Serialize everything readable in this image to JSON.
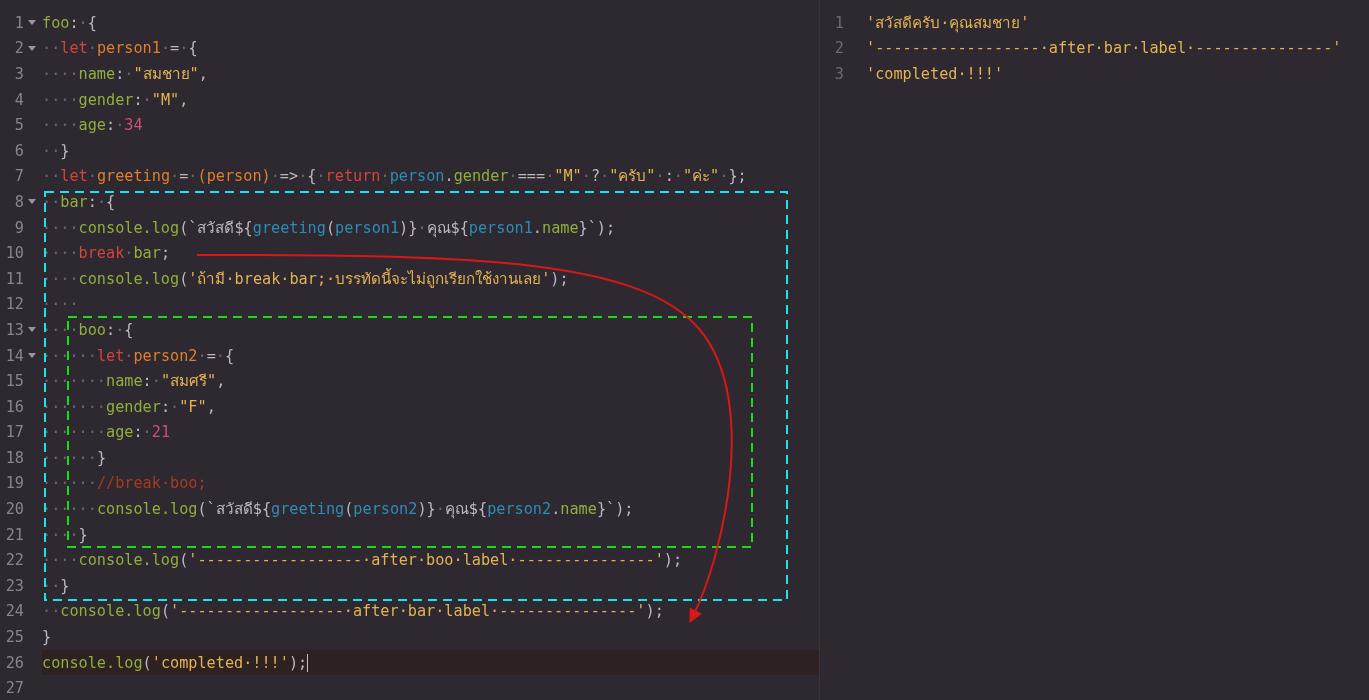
{
  "editor": {
    "lines": [
      {
        "number": "1",
        "fold": true,
        "selected": false,
        "tokens": [
          {
            "kind": "prop",
            "text": "foo"
          },
          {
            "kind": "plain",
            "text": ":"
          },
          {
            "kind": "space",
            "text": "·"
          },
          {
            "kind": "plain",
            "text": "{"
          }
        ]
      },
      {
        "number": "2",
        "fold": true,
        "selected": false,
        "tokens": [
          {
            "kind": "space",
            "text": "··"
          },
          {
            "kind": "keyword",
            "text": "let"
          },
          {
            "kind": "space",
            "text": "·"
          },
          {
            "kind": "var",
            "text": "person1"
          },
          {
            "kind": "space",
            "text": "·"
          },
          {
            "kind": "plain",
            "text": "="
          },
          {
            "kind": "space",
            "text": "·"
          },
          {
            "kind": "plain",
            "text": "{"
          }
        ]
      },
      {
        "number": "3",
        "fold": false,
        "selected": false,
        "tokens": [
          {
            "kind": "space",
            "text": "····"
          },
          {
            "kind": "prop",
            "text": "name"
          },
          {
            "kind": "plain",
            "text": ":"
          },
          {
            "kind": "space",
            "text": "·"
          },
          {
            "kind": "string",
            "text": "\"สมชาย\""
          },
          {
            "kind": "plain",
            "text": ","
          }
        ]
      },
      {
        "number": "4",
        "fold": false,
        "selected": false,
        "tokens": [
          {
            "kind": "space",
            "text": "····"
          },
          {
            "kind": "prop",
            "text": "gender"
          },
          {
            "kind": "plain",
            "text": ":"
          },
          {
            "kind": "space",
            "text": "·"
          },
          {
            "kind": "string",
            "text": "\"M\""
          },
          {
            "kind": "plain",
            "text": ","
          }
        ]
      },
      {
        "number": "5",
        "fold": false,
        "selected": false,
        "tokens": [
          {
            "kind": "space",
            "text": "····"
          },
          {
            "kind": "prop",
            "text": "age"
          },
          {
            "kind": "plain",
            "text": ":"
          },
          {
            "kind": "space",
            "text": "·"
          },
          {
            "kind": "number",
            "text": "34"
          }
        ]
      },
      {
        "number": "6",
        "fold": false,
        "selected": false,
        "tokens": [
          {
            "kind": "space",
            "text": "··"
          },
          {
            "kind": "plain",
            "text": "}"
          }
        ]
      },
      {
        "number": "7",
        "fold": false,
        "selected": false,
        "tokens": [
          {
            "kind": "space",
            "text": "··"
          },
          {
            "kind": "keyword",
            "text": "let"
          },
          {
            "kind": "space",
            "text": "·"
          },
          {
            "kind": "var",
            "text": "greeting"
          },
          {
            "kind": "space",
            "text": "·"
          },
          {
            "kind": "plain",
            "text": "="
          },
          {
            "kind": "space",
            "text": "·"
          },
          {
            "kind": "var",
            "text": "(person)"
          },
          {
            "kind": "space",
            "text": "·"
          },
          {
            "kind": "plain",
            "text": "=>"
          },
          {
            "kind": "space",
            "text": "·"
          },
          {
            "kind": "plain",
            "text": "{"
          },
          {
            "kind": "space",
            "text": "·"
          },
          {
            "kind": "keyword",
            "text": "return"
          },
          {
            "kind": "space",
            "text": "·"
          },
          {
            "kind": "ref",
            "text": "person"
          },
          {
            "kind": "plain",
            "text": "."
          },
          {
            "kind": "prop",
            "text": "gender"
          },
          {
            "kind": "space",
            "text": "·"
          },
          {
            "kind": "plain",
            "text": "==="
          },
          {
            "kind": "space",
            "text": "·"
          },
          {
            "kind": "string",
            "text": "\"M\""
          },
          {
            "kind": "space",
            "text": "·"
          },
          {
            "kind": "plain",
            "text": "?"
          },
          {
            "kind": "space",
            "text": "·"
          },
          {
            "kind": "string",
            "text": "\"ครับ\""
          },
          {
            "kind": "space",
            "text": "·"
          },
          {
            "kind": "plain",
            "text": ":"
          },
          {
            "kind": "space",
            "text": "·"
          },
          {
            "kind": "string",
            "text": "\"ค่ะ\""
          },
          {
            "kind": "space",
            "text": "·"
          },
          {
            "kind": "plain",
            "text": "};"
          }
        ]
      },
      {
        "number": "8",
        "fold": true,
        "selected": false,
        "tokens": [
          {
            "kind": "space",
            "text": "··"
          },
          {
            "kind": "prop",
            "text": "bar"
          },
          {
            "kind": "plain",
            "text": ":"
          },
          {
            "kind": "space",
            "text": "·"
          },
          {
            "kind": "plain",
            "text": "{"
          }
        ]
      },
      {
        "number": "9",
        "fold": false,
        "selected": false,
        "tokens": [
          {
            "kind": "space",
            "text": "····"
          },
          {
            "kind": "prop",
            "text": "console.log"
          },
          {
            "kind": "plain",
            "text": "(`สวัสดี${"
          },
          {
            "kind": "ref",
            "text": "greeting"
          },
          {
            "kind": "plain",
            "text": "("
          },
          {
            "kind": "ref",
            "text": "person1"
          },
          {
            "kind": "plain",
            "text": ")}"
          },
          {
            "kind": "space",
            "text": "·"
          },
          {
            "kind": "plain",
            "text": "คุณ${"
          },
          {
            "kind": "ref",
            "text": "person1"
          },
          {
            "kind": "plain",
            "text": "."
          },
          {
            "kind": "prop",
            "text": "name"
          },
          {
            "kind": "plain",
            "text": "}`);"
          }
        ]
      },
      {
        "number": "10",
        "fold": false,
        "selected": false,
        "tokens": [
          {
            "kind": "space",
            "text": "····"
          },
          {
            "kind": "keyword",
            "text": "break"
          },
          {
            "kind": "space",
            "text": "·"
          },
          {
            "kind": "prop",
            "text": "bar"
          },
          {
            "kind": "plain",
            "text": ";"
          }
        ]
      },
      {
        "number": "11",
        "fold": false,
        "selected": false,
        "tokens": [
          {
            "kind": "space",
            "text": "····"
          },
          {
            "kind": "prop",
            "text": "console.log"
          },
          {
            "kind": "plain",
            "text": "("
          },
          {
            "kind": "string",
            "text": "'ถ้ามี·break·bar;·บรรทัดนี้จะไม่ถูกเรียกใช้งานเลย'"
          },
          {
            "kind": "plain",
            "text": ");"
          }
        ]
      },
      {
        "number": "12",
        "fold": false,
        "selected": false,
        "tokens": [
          {
            "kind": "space",
            "text": "····"
          }
        ]
      },
      {
        "number": "13",
        "fold": true,
        "selected": false,
        "tokens": [
          {
            "kind": "space",
            "text": "····"
          },
          {
            "kind": "prop",
            "text": "boo"
          },
          {
            "kind": "plain",
            "text": ":"
          },
          {
            "kind": "space",
            "text": "·"
          },
          {
            "kind": "plain",
            "text": "{"
          }
        ]
      },
      {
        "number": "14",
        "fold": true,
        "selected": false,
        "tokens": [
          {
            "kind": "space",
            "text": "······"
          },
          {
            "kind": "keyword",
            "text": "let"
          },
          {
            "kind": "space",
            "text": "·"
          },
          {
            "kind": "var",
            "text": "person2"
          },
          {
            "kind": "space",
            "text": "·"
          },
          {
            "kind": "plain",
            "text": "="
          },
          {
            "kind": "space",
            "text": "·"
          },
          {
            "kind": "plain",
            "text": "{"
          }
        ]
      },
      {
        "number": "15",
        "fold": false,
        "selected": false,
        "tokens": [
          {
            "kind": "space",
            "text": "·······"
          },
          {
            "kind": "prop",
            "text": "name"
          },
          {
            "kind": "plain",
            "text": ":"
          },
          {
            "kind": "space",
            "text": "·"
          },
          {
            "kind": "string",
            "text": "\"สมศรี\""
          },
          {
            "kind": "plain",
            "text": ","
          }
        ]
      },
      {
        "number": "16",
        "fold": false,
        "selected": false,
        "tokens": [
          {
            "kind": "space",
            "text": "·······"
          },
          {
            "kind": "prop",
            "text": "gender"
          },
          {
            "kind": "plain",
            "text": ":"
          },
          {
            "kind": "space",
            "text": "·"
          },
          {
            "kind": "string",
            "text": "\"F\""
          },
          {
            "kind": "plain",
            "text": ","
          }
        ]
      },
      {
        "number": "17",
        "fold": false,
        "selected": false,
        "tokens": [
          {
            "kind": "space",
            "text": "·······"
          },
          {
            "kind": "prop",
            "text": "age"
          },
          {
            "kind": "plain",
            "text": ":"
          },
          {
            "kind": "space",
            "text": "·"
          },
          {
            "kind": "number",
            "text": "21"
          }
        ]
      },
      {
        "number": "18",
        "fold": false,
        "selected": false,
        "tokens": [
          {
            "kind": "space",
            "text": "······"
          },
          {
            "kind": "plain",
            "text": "}"
          }
        ]
      },
      {
        "number": "19",
        "fold": false,
        "selected": false,
        "tokens": [
          {
            "kind": "space",
            "text": "······"
          },
          {
            "kind": "comment",
            "text": "//break·boo;"
          }
        ]
      },
      {
        "number": "20",
        "fold": false,
        "selected": false,
        "tokens": [
          {
            "kind": "space",
            "text": "······"
          },
          {
            "kind": "prop",
            "text": "console.log"
          },
          {
            "kind": "plain",
            "text": "(`สวัสดี${"
          },
          {
            "kind": "ref",
            "text": "greeting"
          },
          {
            "kind": "plain",
            "text": "("
          },
          {
            "kind": "ref",
            "text": "person2"
          },
          {
            "kind": "plain",
            "text": ")}"
          },
          {
            "kind": "space",
            "text": "·"
          },
          {
            "kind": "plain",
            "text": "คุณ${"
          },
          {
            "kind": "ref",
            "text": "person2"
          },
          {
            "kind": "plain",
            "text": "."
          },
          {
            "kind": "prop",
            "text": "name"
          },
          {
            "kind": "plain",
            "text": "}`);"
          }
        ]
      },
      {
        "number": "21",
        "fold": false,
        "selected": false,
        "tokens": [
          {
            "kind": "space",
            "text": "····"
          },
          {
            "kind": "plain",
            "text": "}"
          }
        ]
      },
      {
        "number": "22",
        "fold": false,
        "selected": false,
        "tokens": [
          {
            "kind": "space",
            "text": "····"
          },
          {
            "kind": "prop",
            "text": "console.log"
          },
          {
            "kind": "plain",
            "text": "("
          },
          {
            "kind": "string",
            "text": "'------------------·after·boo·label·---------------'"
          },
          {
            "kind": "plain",
            "text": ");"
          }
        ]
      },
      {
        "number": "23",
        "fold": false,
        "selected": false,
        "tokens": [
          {
            "kind": "space",
            "text": "··"
          },
          {
            "kind": "plain",
            "text": "}"
          }
        ]
      },
      {
        "number": "24",
        "fold": false,
        "selected": false,
        "tokens": [
          {
            "kind": "space",
            "text": "··"
          },
          {
            "kind": "prop",
            "text": "console.log"
          },
          {
            "kind": "plain",
            "text": "("
          },
          {
            "kind": "string",
            "text": "'------------------·after·bar·label·---------------'"
          },
          {
            "kind": "plain",
            "text": ");"
          }
        ]
      },
      {
        "number": "25",
        "fold": false,
        "selected": false,
        "tokens": [
          {
            "kind": "plain",
            "text": "}"
          }
        ]
      },
      {
        "number": "26",
        "fold": false,
        "selected": true,
        "tokens": [
          {
            "kind": "prop",
            "text": "console.log"
          },
          {
            "kind": "plain",
            "text": "("
          },
          {
            "kind": "string",
            "text": "'completed·!!!'"
          },
          {
            "kind": "plain",
            "text": ");"
          }
        ]
      },
      {
        "number": "27",
        "fold": false,
        "selected": false
      }
    ]
  },
  "output": {
    "lines": [
      {
        "number": "1",
        "text": "'สวัสดีครับ·คุณสมชาย'"
      },
      {
        "number": "2",
        "text": "'------------------·after·bar·label·---------------'"
      },
      {
        "number": "3",
        "text": "'completed·!!!'"
      }
    ]
  },
  "annotations": [
    {
      "kind": "outline",
      "color": "#19e3ee"
    },
    {
      "kind": "outline",
      "color": "#16dd16"
    },
    {
      "kind": "arrow",
      "color": "#d81818"
    }
  ]
}
